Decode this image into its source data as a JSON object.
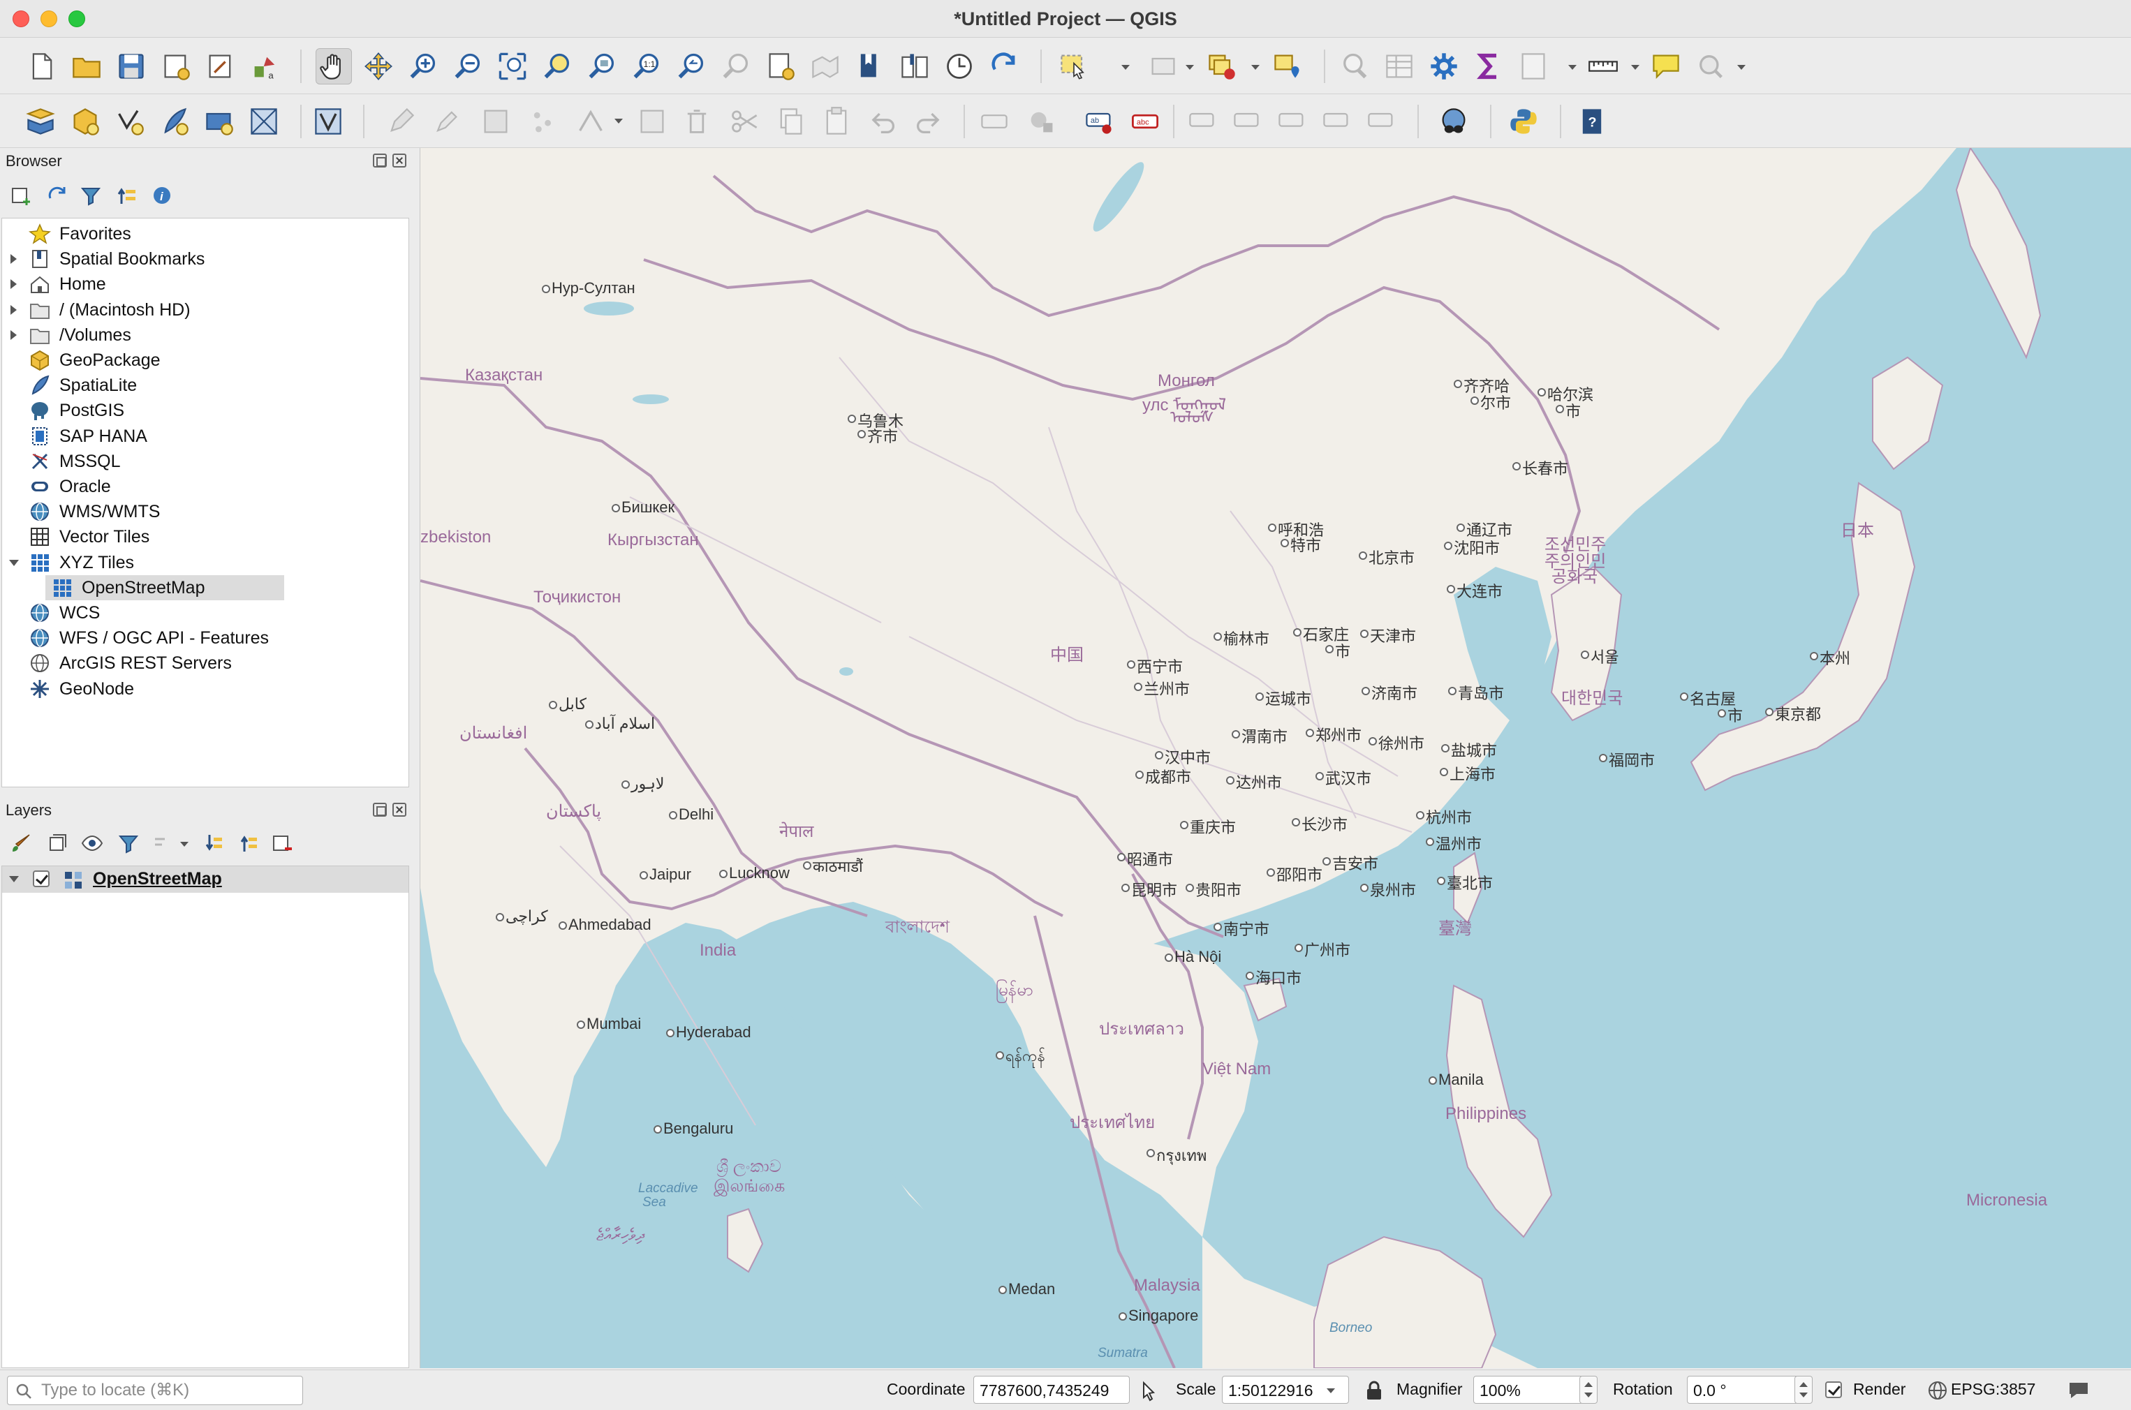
{
  "window": {
    "title": "*Untitled Project — QGIS"
  },
  "browser_panel": {
    "title": "Browser",
    "items": [
      {
        "label": "Favorites",
        "icon": "star-icon",
        "expandable": false
      },
      {
        "label": "Spatial Bookmarks",
        "icon": "bookmark-icon",
        "expandable": true
      },
      {
        "label": "Home",
        "icon": "home-folder-icon",
        "expandable": true
      },
      {
        "label": "/ (Macintosh HD)",
        "icon": "folder-icon",
        "expandable": true
      },
      {
        "label": "/Volumes",
        "icon": "folder-icon",
        "expandable": true
      },
      {
        "label": "GeoPackage",
        "icon": "geopackage-icon",
        "expandable": false
      },
      {
        "label": "SpatiaLite",
        "icon": "spatialite-icon",
        "expandable": false
      },
      {
        "label": "PostGIS",
        "icon": "postgis-elephant-icon",
        "expandable": false
      },
      {
        "label": "SAP HANA",
        "icon": "sap-hana-icon",
        "expandable": false
      },
      {
        "label": "MSSQL",
        "icon": "mssql-icon",
        "expandable": false
      },
      {
        "label": "Oracle",
        "icon": "oracle-icon",
        "expandable": false
      },
      {
        "label": "WMS/WMTS",
        "icon": "globe-icon",
        "expandable": false
      },
      {
        "label": "Vector Tiles",
        "icon": "vector-tiles-icon",
        "expandable": false
      },
      {
        "label": "XYZ Tiles",
        "icon": "xyz-tiles-icon",
        "expandable": true,
        "expanded": true
      },
      {
        "label": "OpenStreetMap",
        "icon": "xyz-tiles-icon",
        "expandable": false,
        "child": true,
        "selected": true
      },
      {
        "label": "WCS",
        "icon": "globe-icon",
        "expandable": false
      },
      {
        "label": "WFS / OGC API - Features",
        "icon": "globe-icon",
        "expandable": false
      },
      {
        "label": "ArcGIS REST Servers",
        "icon": "arcgis-globe-icon",
        "expandable": false
      },
      {
        "label": "GeoNode",
        "icon": "geonode-icon",
        "expandable": false
      }
    ]
  },
  "layers_panel": {
    "title": "Layers",
    "layers": [
      {
        "label": "OpenStreetMap",
        "visible": true
      }
    ]
  },
  "map": {
    "labels": [
      {
        "text": "Нур-Султан",
        "type": "city"
      },
      {
        "text": "Казақстан",
        "type": "country"
      },
      {
        "text": "Монгол",
        "type": "country"
      },
      {
        "text": "улс ᠮᠣᠩᠭᠣᠯ",
        "type": "country"
      },
      {
        "text": "ᠤᠯᠤᠰ",
        "type": "country"
      },
      {
        "text": "齐齐哈",
        "type": "city"
      },
      {
        "text": "尔市",
        "type": "city"
      },
      {
        "text": "哈尔滨",
        "type": "city"
      },
      {
        "text": "市",
        "type": "city"
      },
      {
        "text": "长春市",
        "type": "city"
      },
      {
        "text": "乌鲁木",
        "type": "city"
      },
      {
        "text": "齐市",
        "type": "city"
      },
      {
        "text": "Бишкек",
        "type": "city"
      },
      {
        "text": "zbekiston",
        "type": "country"
      },
      {
        "text": "Кыргызстан",
        "type": "country"
      },
      {
        "text": "Тоҷикистон",
        "type": "country"
      },
      {
        "text": "呼和浩",
        "type": "city"
      },
      {
        "text": "特市",
        "type": "city"
      },
      {
        "text": "通辽市",
        "type": "city"
      },
      {
        "text": "沈阳市",
        "type": "city"
      },
      {
        "text": "北京市",
        "type": "city"
      },
      {
        "text": "조선민주",
        "type": "country"
      },
      {
        "text": "주의인민",
        "type": "country"
      },
      {
        "text": "공화국",
        "type": "country"
      },
      {
        "text": "日本",
        "type": "country"
      },
      {
        "text": "大连市",
        "type": "city"
      },
      {
        "text": "中国",
        "type": "country"
      },
      {
        "text": "西宁市",
        "type": "city"
      },
      {
        "text": "榆林市",
        "type": "city"
      },
      {
        "text": "石家庄",
        "type": "city"
      },
      {
        "text": "市",
        "type": "city"
      },
      {
        "text": "天津市",
        "type": "city"
      },
      {
        "text": "서울",
        "type": "city"
      },
      {
        "text": "本州",
        "type": "city"
      },
      {
        "text": "كابل",
        "type": "city"
      },
      {
        "text": "兰州市",
        "type": "city"
      },
      {
        "text": "运城市",
        "type": "city"
      },
      {
        "text": "济南市",
        "type": "city"
      },
      {
        "text": "青岛市",
        "type": "city"
      },
      {
        "text": "대한민국",
        "type": "country"
      },
      {
        "text": "名古屋",
        "type": "city"
      },
      {
        "text": "市",
        "type": "city"
      },
      {
        "text": "東京都",
        "type": "city"
      },
      {
        "text": "افغانستان",
        "type": "country"
      },
      {
        "text": "اسلام آباد",
        "type": "city"
      },
      {
        "text": "渭南市",
        "type": "city"
      },
      {
        "text": "郑州市",
        "type": "city"
      },
      {
        "text": "徐州市",
        "type": "city"
      },
      {
        "text": "盐城市",
        "type": "city"
      },
      {
        "text": "福岡市",
        "type": "city"
      },
      {
        "text": "汉中市",
        "type": "city"
      },
      {
        "text": "上海市",
        "type": "city"
      },
      {
        "text": "成都市",
        "type": "city"
      },
      {
        "text": "达州市",
        "type": "city"
      },
      {
        "text": "武汉市",
        "type": "city"
      },
      {
        "text": "لاہور",
        "type": "city"
      },
      {
        "text": "پاکستان",
        "type": "country"
      },
      {
        "text": "Delhi",
        "type": "city"
      },
      {
        "text": "नेपाल",
        "type": "country"
      },
      {
        "text": "杭州市",
        "type": "city"
      },
      {
        "text": "重庆市",
        "type": "city"
      },
      {
        "text": "长沙市",
        "type": "city"
      },
      {
        "text": "काठमाडौं",
        "type": "city"
      },
      {
        "text": "温州市",
        "type": "city"
      },
      {
        "text": "昭通市",
        "type": "city"
      },
      {
        "text": "吉安市",
        "type": "city"
      },
      {
        "text": "Jaipur",
        "type": "city"
      },
      {
        "text": "Lucknow",
        "type": "city"
      },
      {
        "text": "邵阳市",
        "type": "city"
      },
      {
        "text": "臺北市",
        "type": "city"
      },
      {
        "text": "昆明市",
        "type": "city"
      },
      {
        "text": "贵阳市",
        "type": "city"
      },
      {
        "text": "泉州市",
        "type": "city"
      },
      {
        "text": "کراچی",
        "type": "city"
      },
      {
        "text": "Ahmedabad",
        "type": "city"
      },
      {
        "text": "বাংলাদেশ",
        "type": "country"
      },
      {
        "text": "臺灣",
        "type": "country"
      },
      {
        "text": "南宁市",
        "type": "city"
      },
      {
        "text": "India",
        "type": "country"
      },
      {
        "text": "广州市",
        "type": "city"
      },
      {
        "text": "Hà Nội",
        "type": "city"
      },
      {
        "text": "海口市",
        "type": "city"
      },
      {
        "text": "မြန်မာ",
        "type": "country"
      },
      {
        "text": "Mumbai",
        "type": "city"
      },
      {
        "text": "Hyderabad",
        "type": "city"
      },
      {
        "text": "ประเทศลาว",
        "type": "country"
      },
      {
        "text": "ရန်ကုန်",
        "type": "city"
      },
      {
        "text": "Việt Nam",
        "type": "country"
      },
      {
        "text": "Manila",
        "type": "city"
      },
      {
        "text": "ประเทศไทย",
        "type": "country"
      },
      {
        "text": "Philippines",
        "type": "country"
      },
      {
        "text": "Bengaluru",
        "type": "city"
      },
      {
        "text": "กรุงเทพ",
        "type": "city"
      },
      {
        "text": "ශ්‍රී ලංකාව",
        "type": "country"
      },
      {
        "text": "இலங்கை",
        "type": "country"
      },
      {
        "text": "Laccadive",
        "type": "sea"
      },
      {
        "text": "Sea",
        "type": "sea"
      },
      {
        "text": "Micronesia",
        "type": "country"
      },
      {
        "text": "ދިވެހިރާއްޖެ",
        "type": "country"
      },
      {
        "text": "Medan",
        "type": "city"
      },
      {
        "text": "Malaysia",
        "type": "country"
      },
      {
        "text": "Singapore",
        "type": "city"
      },
      {
        "text": "Borneo",
        "type": "sea"
      },
      {
        "text": "Sumatra",
        "type": "sea"
      }
    ]
  },
  "statusbar": {
    "locator_placeholder": "Type to locate (⌘K)",
    "coordinate_label": "Coordinate",
    "coordinate_value": "7787600,7435249",
    "scale_label": "Scale",
    "scale_value": "1:50122916",
    "magnifier_label": "Magnifier",
    "magnifier_value": "100%",
    "rotation_label": "Rotation",
    "rotation_value": "0.0 °",
    "render_label": "Render",
    "render_checked": true,
    "crs_label": "EPSG:3857"
  },
  "colors": {
    "water": "#aad3df",
    "land": "#f2efe9",
    "border": "#b596b5",
    "accent_blue": "#2d6db5"
  }
}
